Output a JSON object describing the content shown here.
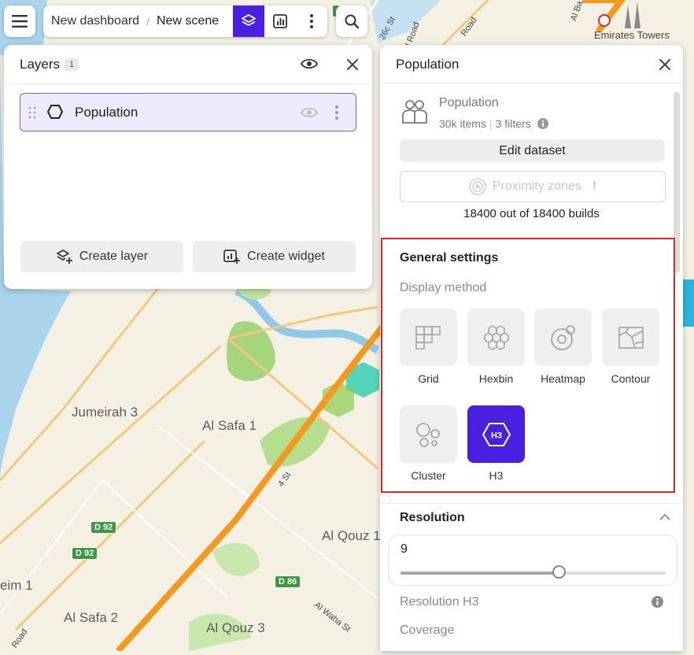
{
  "topbar": {
    "menu_icon": "hamburger-icon",
    "breadcrumb_dashboard": "New dashboard",
    "breadcrumb_separator": "/",
    "breadcrumb_scene": "New scene",
    "search_icon": "search-icon"
  },
  "layers_panel": {
    "title": "Layers",
    "count": "1",
    "items": [
      {
        "label": "Population",
        "icon": "hexagon-icon"
      }
    ],
    "create_layer_label": "Create layer",
    "create_widget_label": "Create widget"
  },
  "props_panel": {
    "title": "Population",
    "dataset_name": "Population",
    "dataset_items": "30k items",
    "dataset_filters": "3 filters",
    "edit_dataset_label": "Edit dataset",
    "proximity_label": "Proximity zones",
    "proximity_warning": "!",
    "builds_text": "18400 out of 18400 builds",
    "general_settings_title": "General settings",
    "display_method_label": "Display method",
    "methods": [
      {
        "label": "Grid",
        "icon": "grid-icon",
        "active": false
      },
      {
        "label": "Hexbin",
        "icon": "hexbin-icon",
        "active": false
      },
      {
        "label": "Heatmap",
        "icon": "heatmap-icon",
        "active": false
      },
      {
        "label": "Contour",
        "icon": "contour-icon",
        "active": false
      },
      {
        "label": "Cluster",
        "icon": "cluster-icon",
        "active": false
      },
      {
        "label": "H3",
        "icon": "h3-icon",
        "active": true
      }
    ],
    "h3_icon_text": "H3",
    "resolution_title": "Resolution",
    "resolution_value": "9",
    "resolution_fraction": 0.6,
    "resolution_h3_label": "Resolution H3",
    "coverage_label": "Coverage"
  },
  "map": {
    "labels": [
      "Jumeirah 3",
      "Al Safa 1",
      "Al Qouz 1",
      "Al Safa 2",
      "Al Qouz 3",
      "eim 1",
      "Emirates Towers"
    ],
    "roads": [
      "26c St",
      "Al Ba",
      "Road",
      "sl Road",
      "4 St",
      "Al Waha St",
      "Road"
    ],
    "shields": [
      "D 92",
      "D 92",
      "D 86"
    ]
  },
  "colors": {
    "accent": "#4a1fe0",
    "highlight": "#e0262e",
    "water": "#a7d3ec",
    "park": "#9ccf73",
    "highway": "#f39a1e"
  }
}
